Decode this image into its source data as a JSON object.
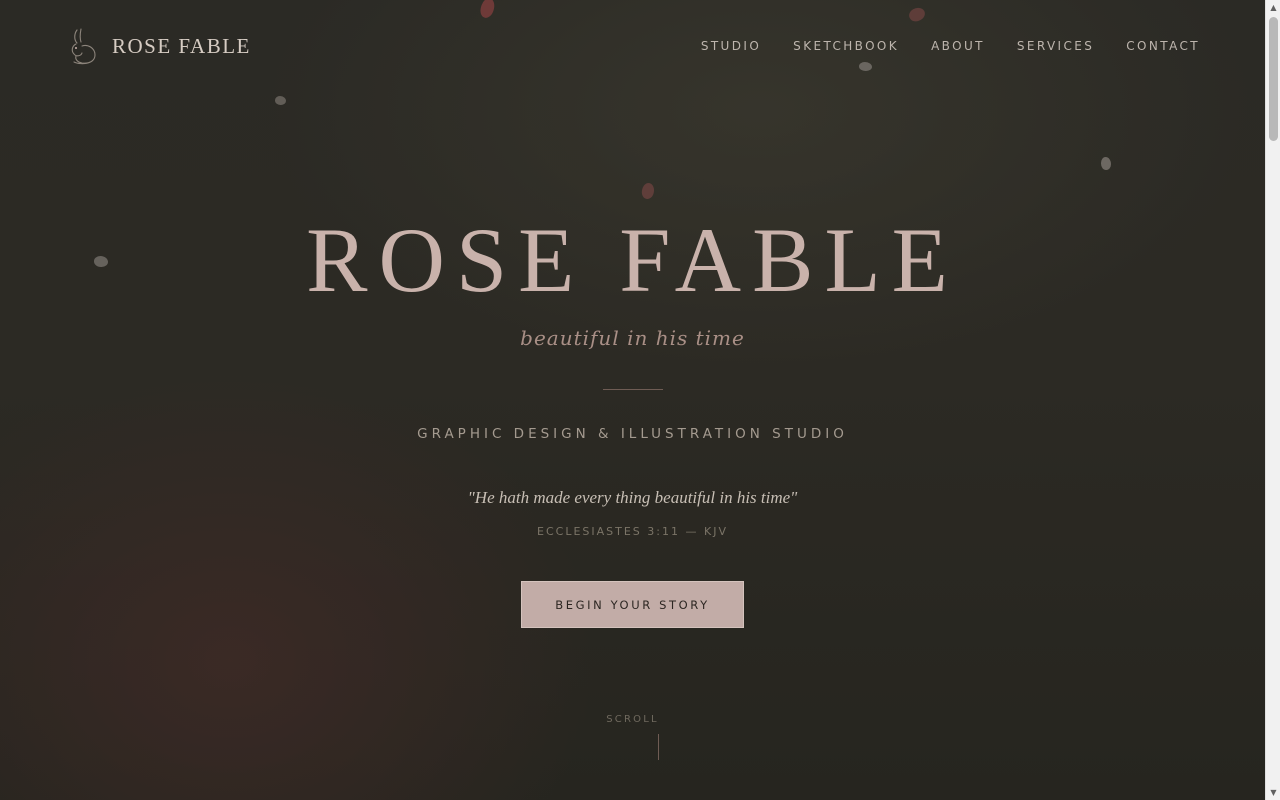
{
  "header": {
    "brand_name": "ROSE FABLE",
    "logo_icon": "rabbit-icon",
    "nav": [
      {
        "label": "STUDIO"
      },
      {
        "label": "SKETCHBOOK"
      },
      {
        "label": "ABOUT"
      },
      {
        "label": "SERVICES"
      },
      {
        "label": "CONTACT"
      }
    ]
  },
  "hero": {
    "title": "ROSE FABLE",
    "tagline": "beautiful in his time",
    "subtitle": "GRAPHIC DESIGN & ILLUSTRATION STUDIO",
    "quote": "\"He hath made every thing beautiful in his time\"",
    "citation": "ECCLESIASTES 3:11 — KJV",
    "cta_label": "BEGIN YOUR STORY",
    "scroll_label": "SCROLL"
  },
  "colors": {
    "background": "#2b2a25",
    "accent_rose": "#c9b2ab",
    "button_fill": "#c2aca7",
    "petal_red": "#6e3a38",
    "petal_grey": "#6a6660"
  }
}
